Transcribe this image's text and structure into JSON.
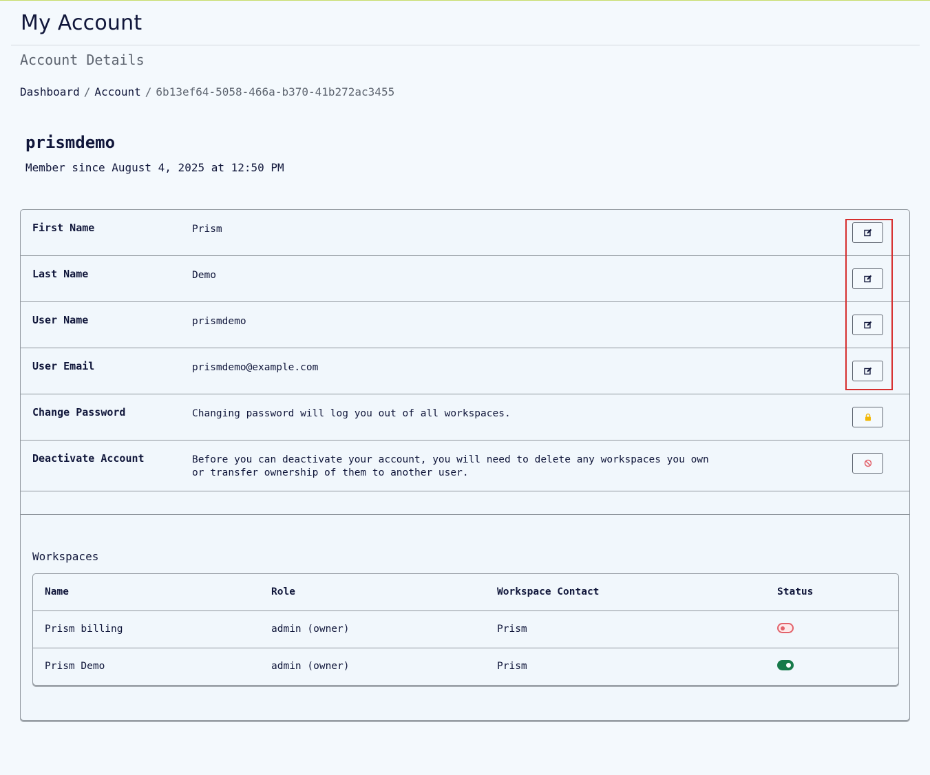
{
  "header": {
    "title": "My Account",
    "subtitle": "Account Details"
  },
  "breadcrumb": {
    "items": [
      "Dashboard",
      "Account"
    ],
    "separator": "/",
    "current": "6b13ef64-5058-466a-b370-41b272ac3455"
  },
  "profile": {
    "username": "prismdemo",
    "member_since": "Member since August 4, 2025 at 12:50 PM"
  },
  "details": [
    {
      "label": "First Name",
      "value": "Prism",
      "action_icon": "edit-icon"
    },
    {
      "label": "Last Name",
      "value": "Demo",
      "action_icon": "edit-icon"
    },
    {
      "label": "User Name",
      "value": "prismdemo",
      "action_icon": "edit-icon"
    },
    {
      "label": "User Email",
      "value": "prismdemo@example.com",
      "action_icon": "edit-icon"
    },
    {
      "label": "Change Password",
      "value": "Changing password will log you out of all workspaces.",
      "action_icon": "lock-icon"
    },
    {
      "label": "Deactivate Account",
      "value_lines": [
        "Before you can deactivate your account, you will need to delete any workspaces you own",
        "or transfer ownership of them to another user."
      ],
      "action_icon": "ban-icon"
    }
  ],
  "workspaces": {
    "title": "Workspaces",
    "columns": [
      "Name",
      "Role",
      "Workspace Contact",
      "Status"
    ],
    "rows": [
      {
        "name": "Prism billing",
        "role": "admin (owner)",
        "contact": "Prism",
        "status": "off"
      },
      {
        "name": "Prism Demo",
        "role": "admin (owner)",
        "contact": "Prism",
        "status": "on"
      }
    ]
  },
  "colors": {
    "accent_text": "#10163a",
    "lock_yellow": "#f2b705",
    "ban_red": "#e2616a",
    "toggle_on": "#177a4a",
    "highlight_red": "#d62e2e"
  }
}
